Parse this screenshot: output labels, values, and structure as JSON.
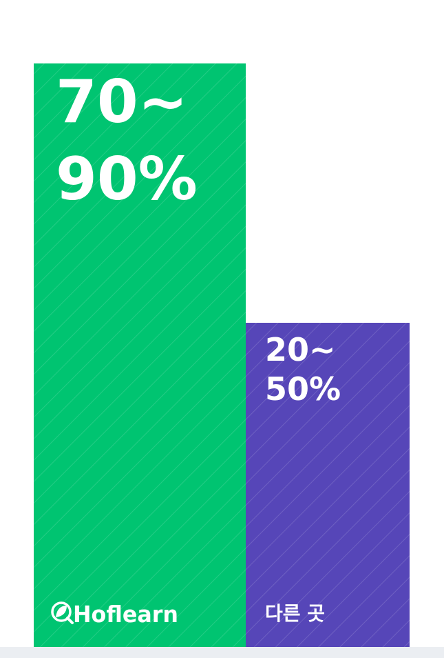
{
  "chart_data": {
    "type": "bar",
    "categories": [
      "Hoflearn",
      "다른 곳"
    ],
    "series": [
      {
        "values": [
          [
            70,
            90
          ],
          [
            20,
            50
          ]
        ],
        "labels": [
          "70~\n90%",
          "20~\n50%"
        ]
      }
    ],
    "ylim": [
      0,
      100
    ],
    "grid": false,
    "legend": "none"
  },
  "colors": {
    "hoflearn_bar": "#00c471",
    "other_bar": "#5646b8",
    "background": "#ffffff",
    "bottom_strip": "#ebeef2"
  },
  "icons": {
    "logo": "leaf-logo-icon"
  }
}
